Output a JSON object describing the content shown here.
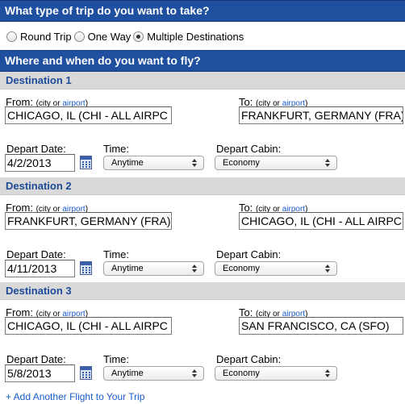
{
  "trip_type": {
    "heading": "What type of trip do you want to take?",
    "options": [
      "Round Trip",
      "One Way",
      "Multiple Destinations"
    ],
    "selected_index": 2
  },
  "where_when": {
    "heading": "Where and when do you want to fly?"
  },
  "labels": {
    "from": "From:",
    "to": "To:",
    "hint_prefix": "(city or ",
    "hint_link": "airport",
    "hint_suffix": ")",
    "depart_date": "Depart Date:",
    "time": "Time:",
    "depart_cabin": "Depart Cabin:"
  },
  "destinations": [
    {
      "title": "Destination 1",
      "from": "CHICAGO, IL (CHI - ALL AIRPC",
      "to": "FRANKFURT, GERMANY (FRA)",
      "date": "4/2/2013",
      "time": "Anytime",
      "cabin": "Economy"
    },
    {
      "title": "Destination 2",
      "from": "FRANKFURT, GERMANY (FRA)",
      "to": "CHICAGO, IL (CHI - ALL AIRPC",
      "date": "4/11/2013",
      "time": "Anytime",
      "cabin": "Economy"
    },
    {
      "title": "Destination 3",
      "from": "CHICAGO, IL (CHI - ALL AIRPC",
      "to": "SAN FRANCISCO, CA (SFO)",
      "date": "5/8/2013",
      "time": "Anytime",
      "cabin": "Economy"
    }
  ],
  "add_flight": "+ Add Another Flight to Your Trip",
  "colors": {
    "header_bg": "#1f4f9f",
    "destination_bar_bg": "#d9d9d9",
    "destination_title": "#1d4a99",
    "link": "#1a5ac9"
  }
}
